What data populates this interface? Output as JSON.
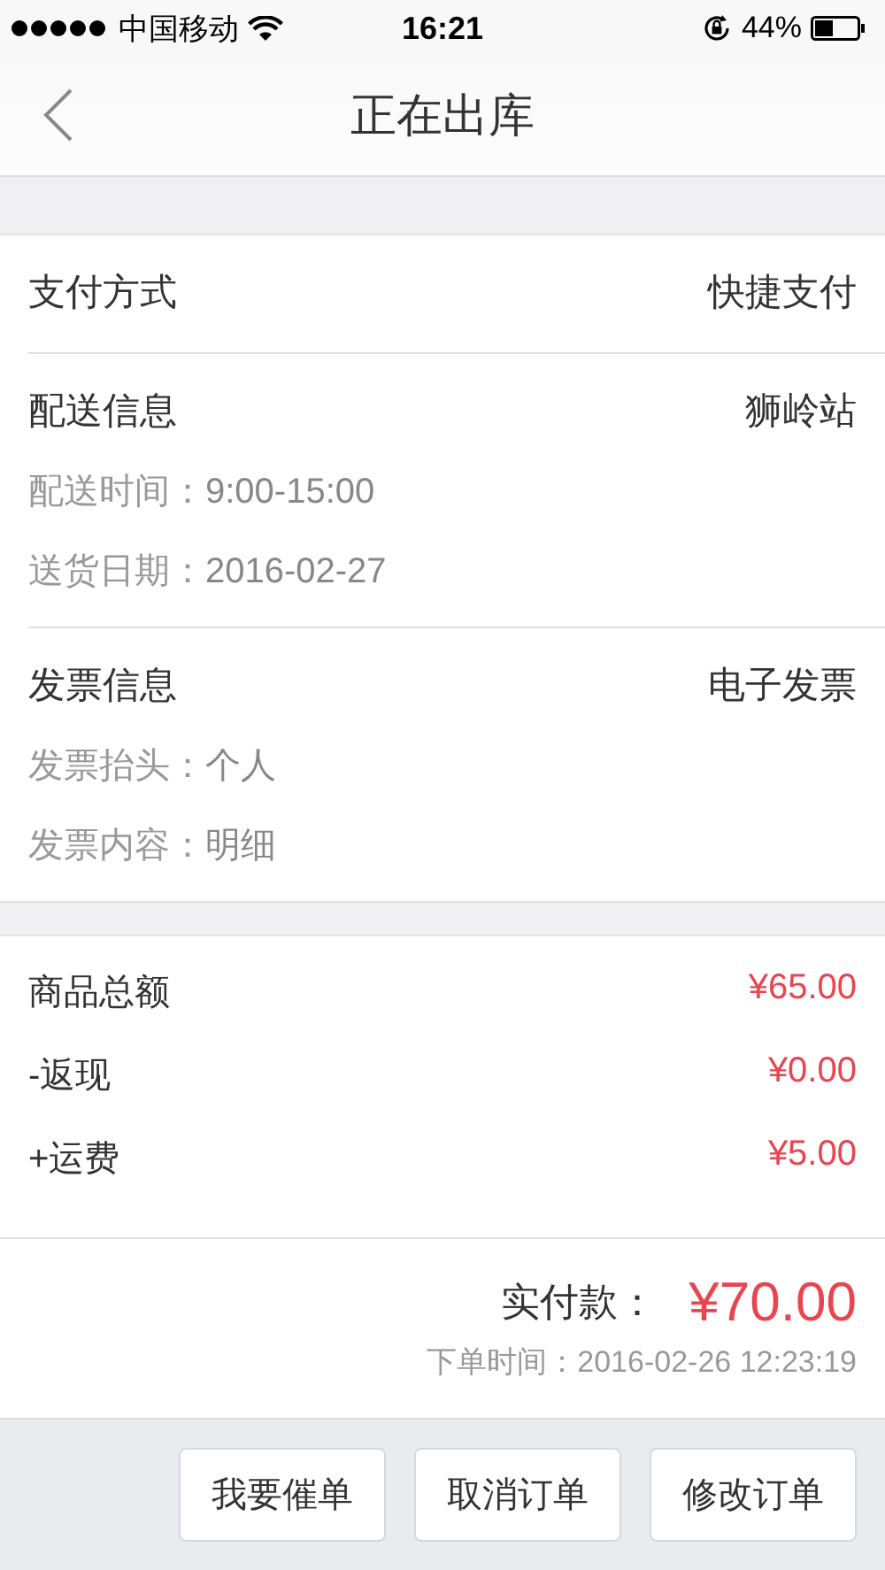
{
  "status_bar": {
    "carrier": "中国移动",
    "time": "16:21",
    "battery": "44%"
  },
  "nav": {
    "title": "正在出库"
  },
  "sections": [
    {
      "label": "支付方式",
      "value": "快捷支付"
    },
    {
      "label": "配送信息",
      "value": "狮岭站",
      "details": [
        {
          "label": "配送时间：",
          "value": "9:00-15:00"
        },
        {
          "label": "送货日期：",
          "value": "2016-02-27"
        }
      ]
    },
    {
      "label": "发票信息",
      "value": "电子发票",
      "details": [
        {
          "label": "发票抬头：",
          "value": "个人"
        },
        {
          "label": "发票内容：",
          "value": "明细"
        }
      ]
    }
  ],
  "amounts": [
    {
      "label": "商品总额",
      "value": "¥65.00"
    },
    {
      "label": "-返现",
      "value": "¥0.00"
    },
    {
      "label": "+运费",
      "value": "¥5.00"
    }
  ],
  "total": {
    "label": "实付款：",
    "value": "¥70.00",
    "order_time": "下单时间：2016-02-26 12:23:19"
  },
  "buttons": [
    "我要催单",
    "取消订单",
    "修改订单"
  ]
}
